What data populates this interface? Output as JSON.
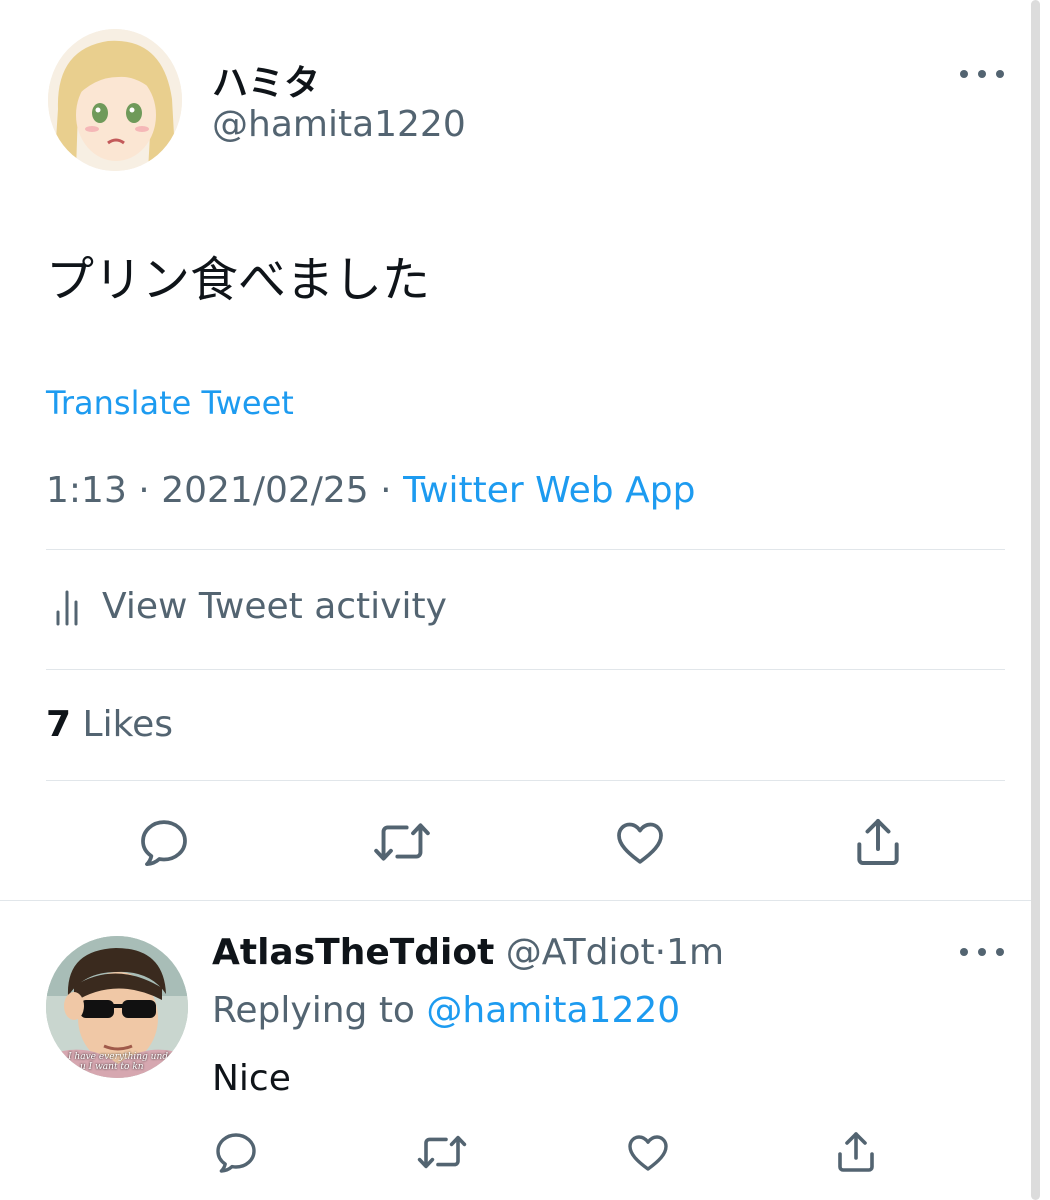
{
  "tweet": {
    "author": {
      "display_name": "ハミタ",
      "handle": "@hamita1220"
    },
    "text": "プリン食べました",
    "translate_label": "Translate Tweet",
    "meta": {
      "time": "1:13",
      "sep1": "·",
      "date": "2021/02/25",
      "sep2": "·",
      "source": "Twitter Web App"
    },
    "activity_label": "View Tweet activity",
    "likes": {
      "count": "7",
      "label": "Likes"
    },
    "actions": [
      "reply-icon",
      "retweet-icon",
      "like-icon",
      "share-icon"
    ]
  },
  "reply": {
    "author": {
      "display_name": "AtlasTheTdiot",
      "handle": "@ATdiot",
      "sep": "·",
      "age": "1m"
    },
    "replying_to": {
      "prefix": "Replying to",
      "handle": "@hamita1220"
    },
    "text": "Nice",
    "avatar_caption": [
      "I have everything unde",
      "u I want to kn"
    ],
    "actions": [
      "reply-icon",
      "retweet-icon",
      "like-icon",
      "share-icon"
    ]
  },
  "colors": {
    "text": "#0f1419",
    "muted": "#536471",
    "accent": "#1d9bf0",
    "divider": "#e1e6ea"
  }
}
